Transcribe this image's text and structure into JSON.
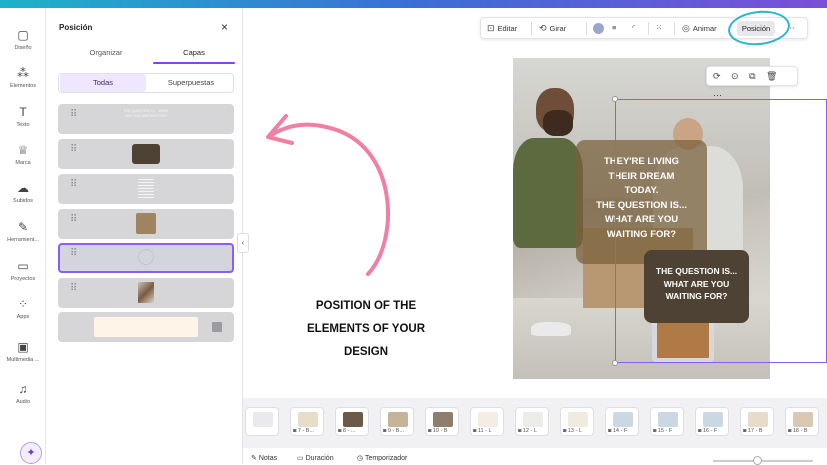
{
  "rail": {
    "items": [
      {
        "label": "Diseño",
        "icon": "layout-icon"
      },
      {
        "label": "Elementos",
        "icon": "shapes-icon"
      },
      {
        "label": "Texto",
        "icon": "text-icon"
      },
      {
        "label": "Marca",
        "icon": "brand-icon"
      },
      {
        "label": "Subidos",
        "icon": "cloud-upload-icon"
      },
      {
        "label": "Herramient...",
        "icon": "tools-icon"
      },
      {
        "label": "Proyectos",
        "icon": "folder-icon"
      },
      {
        "label": "Apps",
        "icon": "apps-icon"
      },
      {
        "label": "Multimedia ...",
        "icon": "media-icon"
      },
      {
        "label": "Audio",
        "icon": "music-icon"
      }
    ],
    "glyphs": [
      "▢",
      "⁂",
      "T",
      "♕",
      "☁",
      "✎",
      "▭",
      "⁘",
      "▣",
      "♫"
    ],
    "magic_glyph": "✦"
  },
  "panel": {
    "title": "Posición",
    "close": "×",
    "tabs": [
      "Organizar",
      "Capas"
    ],
    "active_tab": "Capas",
    "filter": [
      "Todas",
      "Superpuestas"
    ],
    "grip": "⠿",
    "layers": [
      {
        "kind": "text",
        "text": "THE QUESTION IS... WHAT ARE YOU WAITING FOR?"
      },
      {
        "kind": "shape",
        "color": "#4e4234"
      },
      {
        "kind": "text-block"
      },
      {
        "kind": "shape",
        "color": "#9e8461"
      },
      {
        "kind": "selected-empty"
      },
      {
        "kind": "photo"
      },
      {
        "kind": "background",
        "color": "#fff4e8"
      }
    ]
  },
  "annotation": {
    "lines": [
      "POSITION OF THE",
      "ELEMENTS OF YOUR",
      "DESIGN"
    ],
    "arrow_color": "#f07fa3"
  },
  "toolbar": {
    "edit": "Editar",
    "rotate": "Girar",
    "animate": "Animar",
    "position": "Posición",
    "circle_color": "#9aa7c9",
    "ring_color": "#2fb3cd",
    "glyphs": {
      "edit": "⊡",
      "rotate": "⟲",
      "lines": "≡",
      "corner": "◜",
      "transparency": "⁙",
      "animate": "◎",
      "more": "⋯"
    }
  },
  "element_toolbar": {
    "glyphs": "⟳ ⊙ ⧉ 🗑 ⋯"
  },
  "design": {
    "quote1_lines": [
      "THEY'RE LIVING",
      "THEIR DREAM",
      "TODAY.",
      "THE QUESTION IS...",
      "WHAT ARE YOU",
      "WAITING FOR?"
    ],
    "quote2_lines": [
      "THE QUESTION IS...",
      "WHAT ARE YOU",
      "WAITING FOR?"
    ]
  },
  "pages": {
    "items": [
      {
        "label": "",
        "color": "#e9e9ee"
      },
      {
        "label": "7 - B...",
        "color": "#e8ddc8"
      },
      {
        "label": "8 - ...",
        "color": "#6b5a47"
      },
      {
        "label": "9 - B...",
        "color": "#c6b49a"
      },
      {
        "label": "10 - B",
        "color": "#8d7e6e"
      },
      {
        "label": "11 - L",
        "color": "#f3ede5"
      },
      {
        "label": "12 - L",
        "color": "#ecece8"
      },
      {
        "label": "13 - L",
        "color": "#f1eadf"
      },
      {
        "label": "14 - F",
        "color": "#cbd8e4"
      },
      {
        "label": "15 - F",
        "color": "#cbd8e4"
      },
      {
        "label": "16 - F",
        "color": "#cbd8e4"
      },
      {
        "label": "17 - B",
        "color": "#e7dccc"
      },
      {
        "label": "18 - B",
        "color": "#d8c8b4"
      }
    ],
    "label_icon": "◙"
  },
  "footer": {
    "notes": "Notas",
    "duration": "Duración",
    "timer": "Temporizador",
    "glyphs": {
      "notes": "✎",
      "duration": "▭",
      "timer": "◷"
    }
  }
}
